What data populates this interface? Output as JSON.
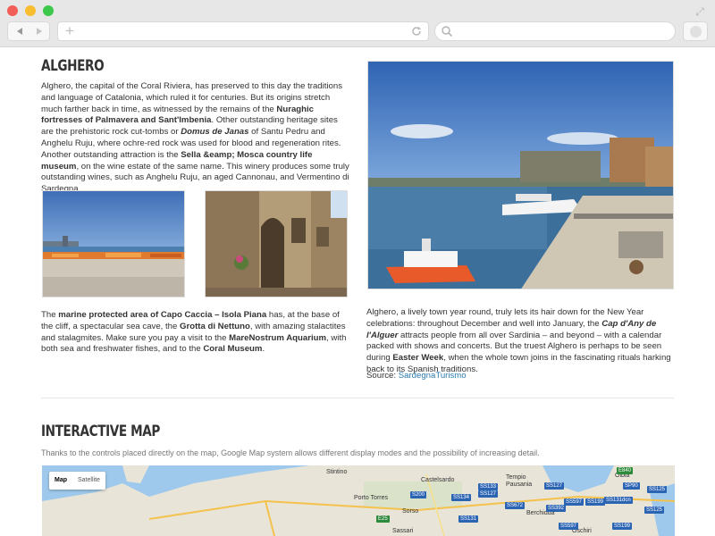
{
  "browser": {
    "url": "",
    "search": ""
  },
  "alghero": {
    "title": "ALGHERO",
    "p1": [
      {
        "t": "Alghero, the capital of the Coral Riviera, has preserved to this day the traditions and language of Catalonia, which ruled it for centuries. But its origins stretch much farther back in time, as witnessed by the remains of the ",
        "b": false
      },
      {
        "t": "Nuraghic fortresses of Palmavera and Sant'Imbenia",
        "b": true
      },
      {
        "t": ". Other outstanding heritage sites are the prehistoric rock cut-tombs or ",
        "b": false
      },
      {
        "t": "Domus de Janas",
        "b": true,
        "i": true
      },
      {
        "t": " of Santu Pedru and Anghelu Ruju, where ochre-red rock was used for blood and regeneration rites. Another outstanding attraction is the ",
        "b": false
      },
      {
        "t": "Sella &eamp; Mosca country life museum",
        "b": true
      },
      {
        "t": ", on the wine estate of the same name. This winery produces some truly outstanding wines, such as Anghelu Ruju, an aged Cannonau, and Vermentino di Sardegna.",
        "b": false
      }
    ],
    "p2": [
      {
        "t": "The ",
        "b": false
      },
      {
        "t": "marine protected area of Capo Caccia – Isola Piana",
        "b": true
      },
      {
        "t": " has, at the base of the cliff, a spectacular sea cave, the ",
        "b": false
      },
      {
        "t": "Grotta di Nettuno",
        "b": true
      },
      {
        "t": ", with amazing stalactites and stalagmites. Make sure you pay a visit to the ",
        "b": false
      },
      {
        "t": "MareNostrum Aquarium",
        "b": true
      },
      {
        "t": ", with both sea and freshwater fishes, and to the ",
        "b": false
      },
      {
        "t": "Coral Museum",
        "b": true
      },
      {
        "t": ".",
        "b": false
      }
    ],
    "p3": [
      {
        "t": "Alghero, a lively town year round, truly lets its hair down for the New Year celebrations: throughout December and well into January, the ",
        "b": false
      },
      {
        "t": "Cap d'Any de l'Alguer",
        "b": true,
        "i": true
      },
      {
        "t": " attracts people from all over Sardinia – and beyond – with a calendar packed with shows and concerts. But the truest Alghero is perhaps to be seen during ",
        "b": false
      },
      {
        "t": "Easter Week",
        "b": true
      },
      {
        "t": ", when the whole town joins in the fascinating rituals harking back to its Spanish traditions.",
        "b": false
      }
    ],
    "source_label": "Source: ",
    "source_link": "SardegnaTurismo"
  },
  "map_section": {
    "title": "INTERACTIVE MAP",
    "description": "Thanks to the controls placed directly on the map, Google Map system allows different display modes and the possibility of increasing detail.",
    "toggle_map": "Map",
    "toggle_satellite": "Satellite",
    "places": [
      "Stintino",
      "Castelsardo",
      "Tempio Pausania",
      "Olbia",
      "Porto Torres",
      "Sorso",
      "Berchidda",
      "Sassari",
      "Oschiri"
    ],
    "shields": [
      "E840",
      "SS133",
      "SS127",
      "SP90",
      "SS125",
      "S200",
      "SS134",
      "SS127",
      "SS672",
      "SS392",
      "SS597",
      "SS199",
      "SS131dcn",
      "SS125",
      "E25",
      "SS131",
      "SS597",
      "SS199"
    ]
  },
  "colors": {
    "link": "#2a7ab0",
    "sea": "#9fc9ec",
    "land": "#e8e4d8"
  }
}
